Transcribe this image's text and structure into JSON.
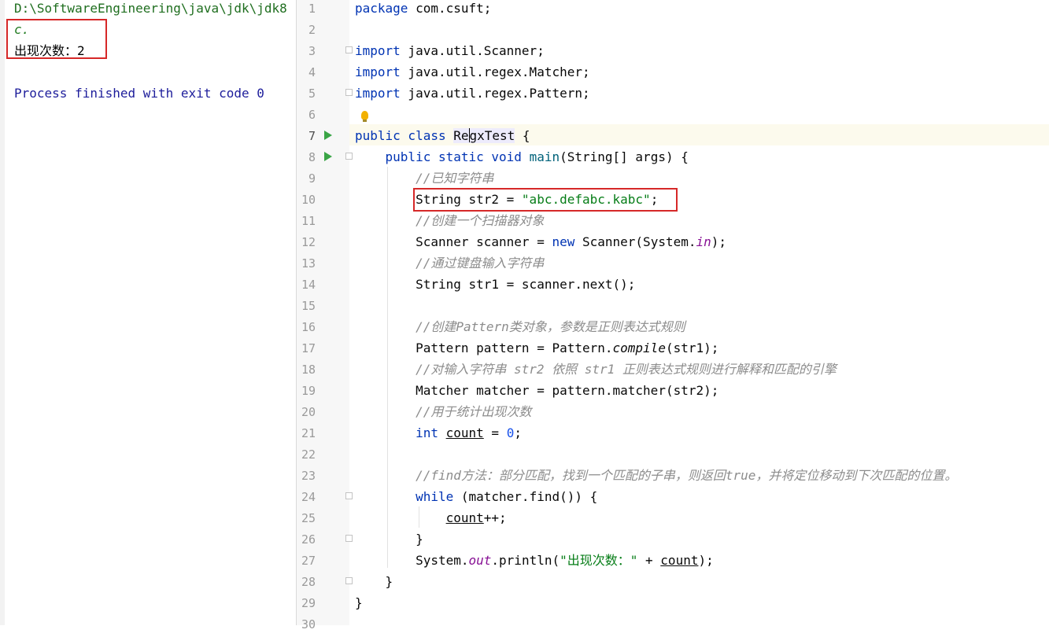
{
  "console": {
    "path": "D:\\SoftwareEngineering\\java\\jdk\\jdk8",
    "input": "c.",
    "result": "出现次数：2",
    "process": "Process finished with exit code 0"
  },
  "gutter": {
    "line_numbers": [
      "1",
      "2",
      "3",
      "4",
      "5",
      "6",
      "7",
      "8",
      "9",
      "10",
      "11",
      "12",
      "13",
      "14",
      "15",
      "16",
      "17",
      "18",
      "19",
      "20",
      "21",
      "22",
      "23",
      "24",
      "25",
      "26",
      "27",
      "28",
      "29",
      "30"
    ]
  },
  "code": {
    "l1_kw": "package",
    "l1_rest": " com.csuft;",
    "l3_kw": "import",
    "l3_rest": " java.util.Scanner;",
    "l4_kw": "import",
    "l4_rest": " java.util.regex.Matcher;",
    "l5_kw": "import",
    "l5_rest": " java.util.regex.Pattern;",
    "l7_kw": "public class ",
    "l7_a": "Re",
    "l7_b": "gxTest",
    "l7_rest": " {",
    "l8_indent": "    ",
    "l8_kw": "public static void ",
    "l8_fn": "main",
    "l8_rest": "(String[] args) {",
    "l9": "        //已知字符串",
    "l10_a": "        String str2 = ",
    "l10_str": "\"abc.defabc.kabc\"",
    "l10_b": ";",
    "l11": "        //创建一个扫描器对象",
    "l12_a": "        Scanner scanner = ",
    "l12_kw": "new",
    "l12_b": " Scanner(System.",
    "l12_in": "in",
    "l12_c": ");",
    "l13": "        //通过键盘输入字符串",
    "l14": "        String str1 = scanner.next();",
    "l16": "        //创建Pattern类对象，参数是正则表达式规则",
    "l17_a": "        Pattern pattern = Pattern.",
    "l17_fn": "compile",
    "l17_b": "(str1);",
    "l18": "        //对输入字符串 str2 依照 str1 正则表达式规则进行解释和匹配的引擎",
    "l19": "        Matcher matcher = pattern.matcher(str2);",
    "l20": "        //用于统计出现次数",
    "l21_indent": "        ",
    "l21_kw": "int",
    "l21_sp": " ",
    "l21_var": "count",
    "l21_eq": " = ",
    "l21_num": "0",
    "l21_end": ";",
    "l23": "        //find方法：部分匹配，找到一个匹配的子串，则返回true，并将定位移动到下次匹配的位置。",
    "l24_indent": "        ",
    "l24_kw": "while",
    "l24_rest": " (matcher.find()) {",
    "l25_indent": "            ",
    "l25_var": "count",
    "l25_rest": "++;",
    "l26": "        }",
    "l27_a": "        System.",
    "l27_out": "out",
    "l27_b": ".println(",
    "l27_str": "\"出现次数：\"",
    "l27_c": " + ",
    "l27_var": "count",
    "l27_d": ");",
    "l28": "    }",
    "l29": "}"
  }
}
